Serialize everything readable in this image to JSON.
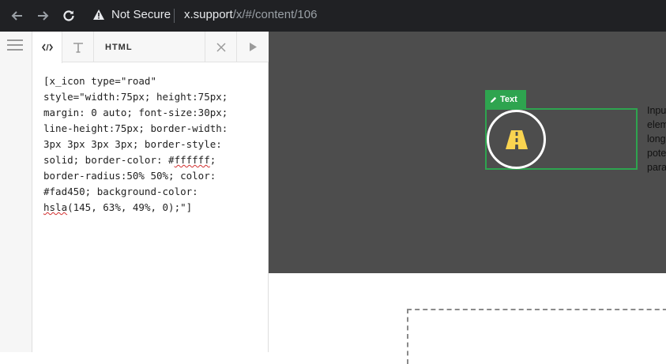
{
  "browser": {
    "security_label": "Not Secure",
    "url_host": "x.support",
    "url_path": "/x/#/content/106"
  },
  "editor": {
    "tabs": {
      "html_label": "HTML"
    },
    "code_lines": [
      "[x_icon type=\"road\"",
      "style=\"width:75px; height:75px;",
      "margin: 0 auto; font-size:30px;",
      "line-height:75px; border-width:",
      "3px 3px 3px 3px; border-style:",
      "solid; border-color: #ffffff;",
      "border-radius:50% 50%; color:",
      "#fad450; background-color:",
      "hsla(145, 63%, 49%, 0);\"]"
    ]
  },
  "preview": {
    "badge_label": "Text",
    "side_text_lines": [
      "Inpu",
      "elem",
      "long",
      "pote",
      "para"
    ]
  },
  "colors": {
    "accent_green": "#2ea44f",
    "icon_color": "#fad450",
    "preview_bg": "#4d4d4d",
    "browser_bar": "#202124"
  },
  "icons": {
    "back": "arrow-left-icon",
    "forward": "arrow-right-icon",
    "reload": "reload-icon",
    "warning": "warning-triangle-icon",
    "menu": "hamburger-icon",
    "code": "code-icon",
    "text": "text-t-icon",
    "close": "close-x-icon",
    "play": "play-icon",
    "pencil": "pencil-icon",
    "road": "road-icon"
  }
}
